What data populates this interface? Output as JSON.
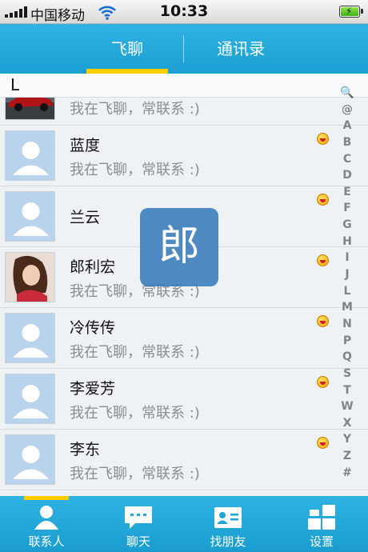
{
  "status_bar": {
    "carrier": "中国移动",
    "time": "10:33",
    "icons": [
      "signal-icon",
      "wifi-icon",
      "battery-charging-icon"
    ]
  },
  "top_tabs": [
    {
      "label": "飞聊",
      "active": true
    },
    {
      "label": "通讯录",
      "active": false
    }
  ],
  "section_header": "L",
  "contacts": [
    {
      "name": "",
      "status": "我在飞聊，常联系 :)",
      "avatar": "car-photo",
      "online": false
    },
    {
      "name": "蓝度",
      "status": "我在飞聊，常联系 :)",
      "avatar": "default-person-icon",
      "online": true
    },
    {
      "name": "兰云",
      "status": "",
      "avatar": "default-person-icon",
      "online": true
    },
    {
      "name": "郎利宏",
      "status": "我在飞聊，常联系 :)",
      "avatar": "woman-photo",
      "online": true
    },
    {
      "name": "冷传传",
      "status": "我在飞聊，常联系 :)",
      "avatar": "default-person-icon",
      "online": true
    },
    {
      "name": "李爱芳",
      "status": "我在飞聊，常联系 :)",
      "avatar": "default-person-icon",
      "online": true
    },
    {
      "name": "李东",
      "status": "我在飞聊，常联系 :)",
      "avatar": "default-person-icon",
      "online": true
    }
  ],
  "index_letters": [
    "🔍",
    "@",
    "A",
    "B",
    "C",
    "D",
    "E",
    "F",
    "G",
    "H",
    "I",
    "J",
    "L",
    "M",
    "N",
    "P",
    "Q",
    "S",
    "T",
    "W",
    "X",
    "Y",
    "Z",
    "#"
  ],
  "overlay_letter": "郎",
  "bottom_tabs": [
    {
      "label": "联系人",
      "icon": "person-icon",
      "active": true
    },
    {
      "label": "聊天",
      "icon": "chat-bubble-icon",
      "active": false
    },
    {
      "label": "找朋友",
      "icon": "contact-card-icon",
      "active": false
    },
    {
      "label": "设置",
      "icon": "settings-grid-icon",
      "active": false
    }
  ],
  "colors": {
    "header_blue": "#1b9fd2",
    "accent_yellow": "#ffcc00",
    "list_bg": "#eef2f5",
    "overlay_blue": "#3478b8"
  }
}
